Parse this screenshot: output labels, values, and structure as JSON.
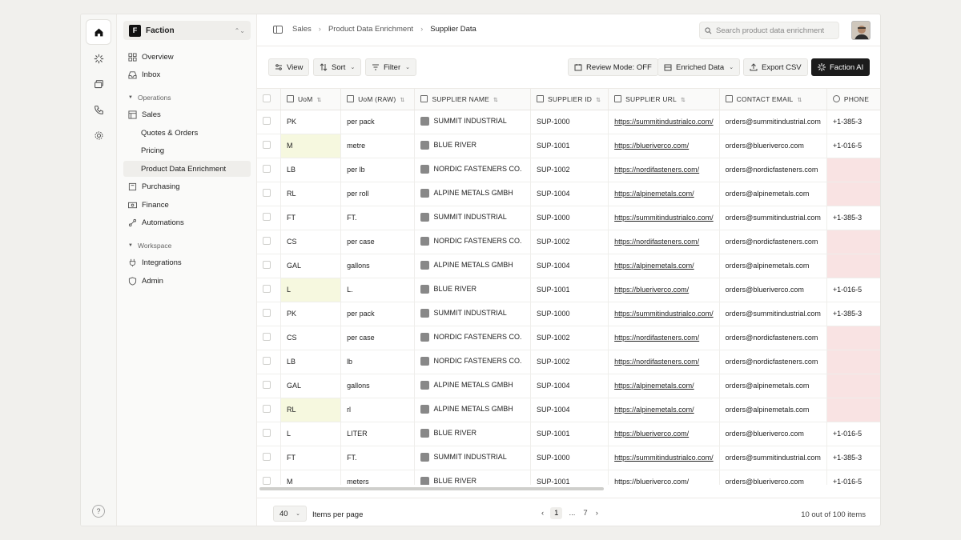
{
  "workspace": {
    "logo": "F",
    "name": "Faction"
  },
  "sidebar": {
    "items": [
      {
        "label": "Overview"
      },
      {
        "label": "Inbox"
      }
    ],
    "section_operations": "Operations",
    "operations": [
      {
        "label": "Sales"
      },
      {
        "label": "Quotes & Orders"
      },
      {
        "label": "Pricing"
      },
      {
        "label": "Product Data Enrichment"
      },
      {
        "label": "Purchasing"
      },
      {
        "label": "Finance"
      },
      {
        "label": "Automations"
      }
    ],
    "section_workspace": "Workspace",
    "workspace_items": [
      {
        "label": "Integrations"
      },
      {
        "label": "Admin"
      }
    ],
    "help": "?"
  },
  "breadcrumb": [
    "Sales",
    "Product Data Enrichment",
    "Supplier Data"
  ],
  "search": {
    "placeholder": "Search product data enrichment"
  },
  "toolbar": {
    "view": "View",
    "sort": "Sort",
    "filter": "Filter",
    "review_mode": "Review Mode: OFF",
    "enriched": "Enriched Data",
    "export": "Export CSV",
    "ai": "Faction AI"
  },
  "table": {
    "headers": [
      "UoM",
      "UoM (RAW)",
      "SUPPLIER NAME",
      "SUPPLIER ID",
      "SUPPLIER URL",
      "CONTACT EMAIL",
      "PHONE"
    ],
    "rows": [
      [
        "PK",
        "per pack",
        "SUMMIT INDUSTRIAL",
        "SUP-1000",
        "https://summitindustrialco.com/",
        "orders@summitindustrial.com",
        "+1-385-3"
      ],
      [
        "M",
        "metre",
        "BLUE RIVER",
        "SUP-1001",
        "https://blueriverco.com/",
        "orders@blueriverco.com",
        "+1-016-5"
      ],
      [
        "LB",
        "per lb",
        "NORDIC FASTENERS CO.",
        "SUP-1002",
        "https://nordifasteners.com/",
        "orders@nordicfasteners.com",
        ""
      ],
      [
        "RL",
        "per roll",
        "ALPINE METALS GMBH",
        "SUP-1004",
        "https://alpinemetals.com/",
        "orders@alpinemetals.com",
        ""
      ],
      [
        "FT",
        "FT.",
        "SUMMIT INDUSTRIAL",
        "SUP-1000",
        "https://summitindustrialco.com/",
        "orders@summitindustrial.com",
        "+1-385-3"
      ],
      [
        "CS",
        "per case",
        "NORDIC FASTENERS CO.",
        "SUP-1002",
        "https://nordifasteners.com/",
        "orders@nordicfasteners.com",
        ""
      ],
      [
        "GAL",
        "gallons",
        "ALPINE METALS GMBH",
        "SUP-1004",
        "https://alpinemetals.com/",
        "orders@alpinemetals.com",
        ""
      ],
      [
        "L",
        "L.",
        "BLUE RIVER",
        "SUP-1001",
        "https://blueriverco.com/",
        "orders@blueriverco.com",
        "+1-016-5"
      ],
      [
        "PK",
        "per pack",
        "SUMMIT INDUSTRIAL",
        "SUP-1000",
        "https://summitindustrialco.com/",
        "orders@summitindustrial.com",
        "+1-385-3"
      ],
      [
        "CS",
        "per case",
        "NORDIC FASTENERS CO.",
        "SUP-1002",
        "https://nordifasteners.com/",
        "orders@nordicfasteners.com",
        ""
      ],
      [
        "LB",
        "lb",
        "NORDIC FASTENERS CO.",
        "SUP-1002",
        "https://nordifasteners.com/",
        "orders@nordicfasteners.com",
        ""
      ],
      [
        "GAL",
        "gallons",
        "ALPINE METALS GMBH",
        "SUP-1004",
        "https://alpinemetals.com/",
        "orders@alpinemetals.com",
        ""
      ],
      [
        "RL",
        "rl",
        "ALPINE METALS GMBH",
        "SUP-1004",
        "https://alpinemetals.com/",
        "orders@alpinemetals.com",
        ""
      ],
      [
        "L",
        "LITER",
        "BLUE RIVER",
        "SUP-1001",
        "https://blueriverco.com/",
        "orders@blueriverco.com",
        "+1-016-5"
      ],
      [
        "FT",
        "FT.",
        "SUMMIT INDUSTRIAL",
        "SUP-1000",
        "https://summitindustrialco.com/",
        "orders@summitindustrial.com",
        "+1-385-3"
      ],
      [
        "M",
        "meters",
        "BLUE RIVER",
        "SUP-1001",
        "https://blueriverco.com/",
        "orders@blueriverco.com",
        "+1-016-5"
      ]
    ],
    "highlight_uom_rows": [
      1,
      7,
      12
    ],
    "highlight_phone_rows": [
      2,
      3,
      5,
      6,
      9,
      10,
      11,
      12
    ]
  },
  "footer": {
    "per_page": "40",
    "per_page_label": "Items per page",
    "prev": "‹",
    "current_page": "1",
    "ellipsis": "...",
    "last_page": "7",
    "next": "›",
    "count": "10 out of 100 items"
  },
  "colors": {
    "uom_highlight": "#f6f8df",
    "phone_highlight": "#f9e3e3",
    "primary_button": "#1c1c1c"
  }
}
